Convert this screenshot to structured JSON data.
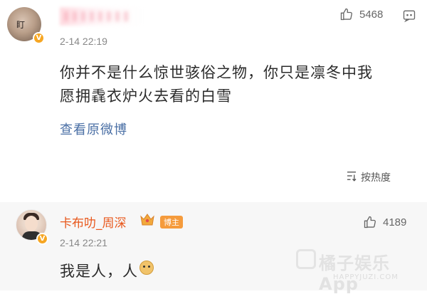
{
  "comment1": {
    "time": "2-14 22:19",
    "likes": "5468",
    "text_line1": "你并不是什么惊世骇俗之物，你只是凛冬中我",
    "text_line2": "愿拥毳衣炉火去看的白雪",
    "view_original": "查看原微博",
    "avatar_text": "盯",
    "verified_icon": "v-badge-icon"
  },
  "sort": {
    "label": "按热度",
    "icon": "sort-icon"
  },
  "comment2": {
    "name": "卡布叻_周深",
    "badge": "博主",
    "time": "2-14 22:21",
    "likes": "4189",
    "text": "我是人，人",
    "emoji_icon": "doge-emoji-icon",
    "crown_icon": "crown-icon"
  },
  "watermark": {
    "text": "橘子娱乐App",
    "url": "HAPPYJUZI.COM"
  },
  "colors": {
    "accent_link": "#4a6fa5",
    "name_orange": "#e8581c",
    "badge": "#f59b3c"
  }
}
